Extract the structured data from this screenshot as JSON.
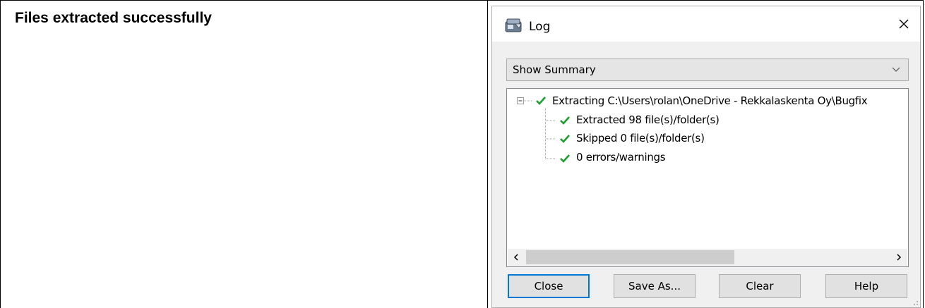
{
  "page": {
    "heading": "Files extracted successfully"
  },
  "dialog": {
    "title": "Log",
    "icons": {
      "app": "archive-app-icon",
      "close": "close-icon"
    },
    "dropdown": {
      "selected": "Show Summary"
    },
    "tree": [
      {
        "label": "Extracting C:\\Users\\rolan\\OneDrive - Rekkalaskenta Oy\\Bugfix",
        "status": "check-icon",
        "expanded": true
      },
      {
        "label": "Extracted 98 file(s)/folder(s)",
        "status": "check-icon"
      },
      {
        "label": "Skipped 0 file(s)/folder(s)",
        "status": "check-icon"
      },
      {
        "label": "0 errors/warnings",
        "status": "check-icon"
      }
    ],
    "buttons": {
      "close": "Close",
      "save_as": "Save As...",
      "clear": "Clear",
      "help": "Help"
    },
    "colors": {
      "check": "#1e9e2e",
      "accent": "#0078d7"
    }
  }
}
